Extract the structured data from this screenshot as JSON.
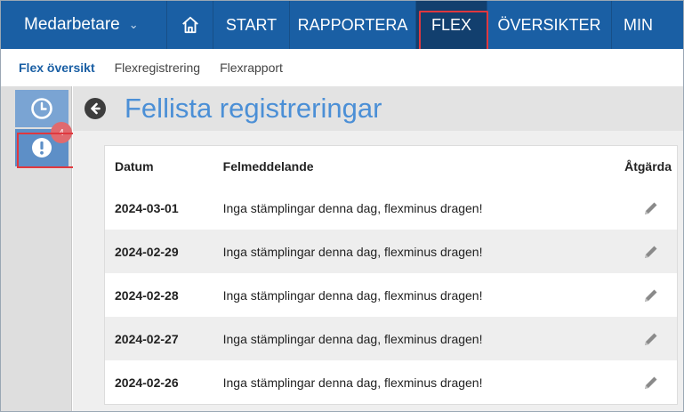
{
  "topnav": {
    "brand": "Medarbetare",
    "start": "START",
    "rapportera": "RAPPORTERA",
    "flex": "FLEX",
    "oversikter": "ÖVERSIKTER",
    "min": "MIN"
  },
  "subnav": {
    "items": [
      "Flex översikt",
      "Flexregistrering",
      "Flexrapport"
    ]
  },
  "sidebar": {
    "badge_count": "4"
  },
  "page": {
    "title": "Fellista registreringar"
  },
  "table": {
    "columns": [
      "Datum",
      "Felmeddelande",
      "Åtgärda"
    ],
    "rows": [
      {
        "date": "2024-03-01",
        "message": "Inga stämplingar denna dag, flexminus dragen!"
      },
      {
        "date": "2024-02-29",
        "message": "Inga stämplingar denna dag, flexminus dragen!"
      },
      {
        "date": "2024-02-28",
        "message": "Inga stämplingar denna dag, flexminus dragen!"
      },
      {
        "date": "2024-02-27",
        "message": "Inga stämplingar denna dag, flexminus dragen!"
      },
      {
        "date": "2024-02-26",
        "message": "Inga stämplingar denna dag, flexminus dragen!"
      }
    ]
  },
  "colors": {
    "nav_bg": "#1a5fa4",
    "nav_active": "#123f6e",
    "highlight": "#e0383e",
    "title": "#4b8fd6"
  }
}
